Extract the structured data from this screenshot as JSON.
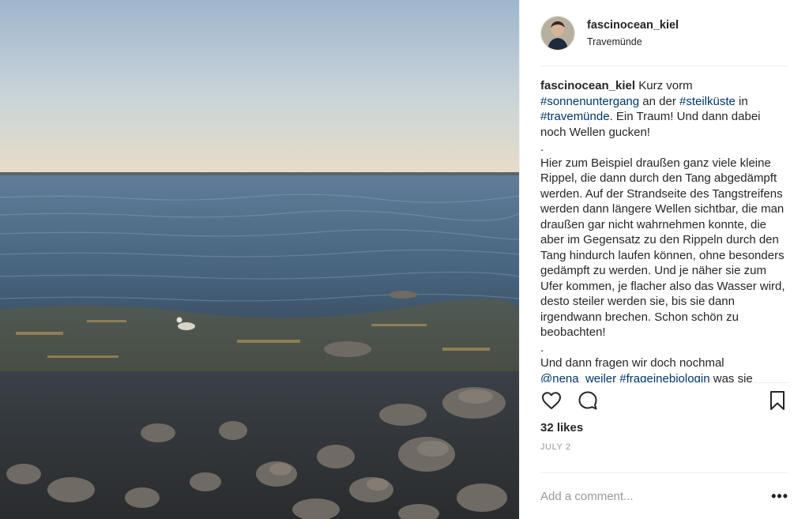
{
  "photo": {
    "alt_subject": "sea-shore-photo"
  },
  "header": {
    "username": "fascinocean_kiel",
    "location": "Travemünde"
  },
  "caption": {
    "username": "fascinocean_kiel",
    "line1_a": " Kurz vorm ",
    "tag_sonnenuntergang": "#sonnenuntergang",
    "line1_b": " an der ",
    "tag_steilkueste": "#steilküste",
    "line1_c": " in ",
    "tag_travemuende": "#travemünde",
    "line1_d": ". Ein Traum! Und dann dabei noch Wellen gucken!",
    "dot1": ".",
    "paragraph2": "Hier zum Beispiel draußen ganz viele kleine Rippel, die dann durch den Tang abgedämpft werden. Auf der Strandseite des Tangstreifens werden dann längere Wellen sichtbar, die man draußen gar nicht wahrnehmen konnte, die aber im Gegensatz zu den Rippeln durch den Tang hindurch laufen können, ohne besonders gedämpft zu werden. Und je näher sie zum Ufer kommen, je flacher also das Wasser wird, desto steiler werden sie, bis sie dann irgendwann brechen. Schon schön zu beobachten!",
    "dot2": ".",
    "line3_a": "Und dann fragen wir doch nochmal ",
    "mention": "@nena_weiler",
    "line3_b": " ",
    "tag_frageinebiologin": "#frageinebiologin",
    "line3_c": " was sie"
  },
  "actions": {
    "like_icon": "heart-icon",
    "comment_icon": "comment-icon",
    "save_icon": "bookmark-icon"
  },
  "likes": "32 likes",
  "date": "JULY 2",
  "comment": {
    "placeholder": "Add a comment...",
    "more": "•••"
  },
  "colors": {
    "link": "#003569",
    "border": "#efefef",
    "muted": "#999999",
    "text": "#262626"
  }
}
